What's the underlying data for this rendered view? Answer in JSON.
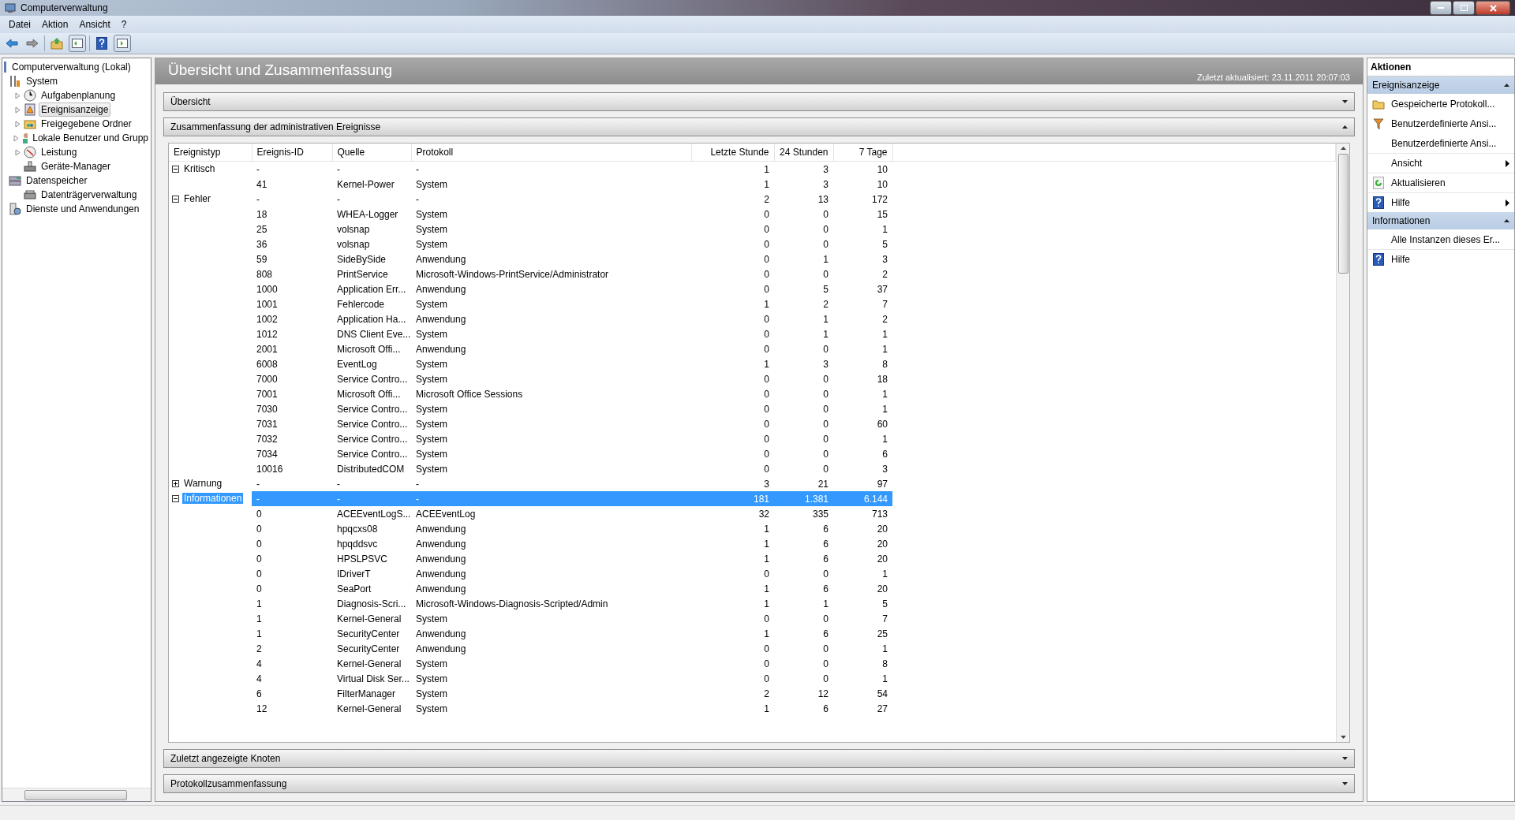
{
  "window": {
    "title": "Computerverwaltung"
  },
  "menu": [
    "Datei",
    "Aktion",
    "Ansicht",
    "?"
  ],
  "tree": [
    {
      "label": "Computerverwaltung (Lokal)",
      "selected": false,
      "children": [
        {
          "label": "System",
          "selected": false,
          "children": [
            {
              "label": "Aufgabenplanung",
              "selected": false,
              "collapsed": true
            },
            {
              "label": "Ereignisanzeige",
              "selected": true,
              "collapsed": true
            },
            {
              "label": "Freigegebene Ordner",
              "selected": false,
              "collapsed": true
            },
            {
              "label": "Lokale Benutzer und Grupp",
              "selected": false,
              "collapsed": true
            },
            {
              "label": "Leistung",
              "selected": false,
              "collapsed": true
            },
            {
              "label": "Geräte-Manager",
              "selected": false,
              "collapsed": false
            }
          ]
        },
        {
          "label": "Datenspeicher",
          "selected": false,
          "children": [
            {
              "label": "Datenträgerverwaltung",
              "selected": false,
              "collapsed": false
            }
          ]
        },
        {
          "label": "Dienste und Anwendungen",
          "selected": false
        }
      ]
    }
  ],
  "header": {
    "title": "Übersicht und Zusammenfassung",
    "updated": "Zuletzt aktualisiert: 23.11.2011 20:07:03"
  },
  "panels": [
    {
      "title": "Übersicht",
      "expanded": false
    },
    {
      "title": "Zusammenfassung der administrativen Ereignisse",
      "expanded": true,
      "table": {
        "columns": [
          "Ereignistyp",
          "Ereignis-ID",
          "Quelle",
          "Protokoll",
          "Letzte Stunde",
          "24 Stunden",
          "7 Tage"
        ],
        "groups": [
          {
            "type": "Kritisch",
            "expanded": true,
            "selected": false,
            "id": "-",
            "source": "-",
            "log": "-",
            "hour": "1",
            "day": "3",
            "week": "10",
            "children": [
              {
                "id": "41",
                "source": "Kernel-Power",
                "log": "System",
                "hour": "1",
                "day": "3",
                "week": "10"
              }
            ]
          },
          {
            "type": "Fehler",
            "expanded": true,
            "selected": false,
            "id": "-",
            "source": "-",
            "log": "-",
            "hour": "2",
            "day": "13",
            "week": "172",
            "children": [
              {
                "id": "18",
                "source": "WHEA-Logger",
                "log": "System",
                "hour": "0",
                "day": "0",
                "week": "15"
              },
              {
                "id": "25",
                "source": "volsnap",
                "log": "System",
                "hour": "0",
                "day": "0",
                "week": "1"
              },
              {
                "id": "36",
                "source": "volsnap",
                "log": "System",
                "hour": "0",
                "day": "0",
                "week": "5"
              },
              {
                "id": "59",
                "source": "SideBySide",
                "log": "Anwendung",
                "hour": "0",
                "day": "1",
                "week": "3"
              },
              {
                "id": "808",
                "source": "PrintService",
                "log": "Microsoft-Windows-PrintService/Administrator",
                "hour": "0",
                "day": "0",
                "week": "2"
              },
              {
                "id": "1000",
                "source": "Application Err...",
                "log": "Anwendung",
                "hour": "0",
                "day": "5",
                "week": "37"
              },
              {
                "id": "1001",
                "source": "Fehlercode",
                "log": "System",
                "hour": "1",
                "day": "2",
                "week": "7"
              },
              {
                "id": "1002",
                "source": "Application Ha...",
                "log": "Anwendung",
                "hour": "0",
                "day": "1",
                "week": "2"
              },
              {
                "id": "1012",
                "source": "DNS Client Eve...",
                "log": "System",
                "hour": "0",
                "day": "1",
                "week": "1"
              },
              {
                "id": "2001",
                "source": "Microsoft Offi...",
                "log": "Anwendung",
                "hour": "0",
                "day": "0",
                "week": "1"
              },
              {
                "id": "6008",
                "source": "EventLog",
                "log": "System",
                "hour": "1",
                "day": "3",
                "week": "8"
              },
              {
                "id": "7000",
                "source": "Service Contro...",
                "log": "System",
                "hour": "0",
                "day": "0",
                "week": "18"
              },
              {
                "id": "7001",
                "source": "Microsoft Offi...",
                "log": "Microsoft Office Sessions",
                "hour": "0",
                "day": "0",
                "week": "1"
              },
              {
                "id": "7030",
                "source": "Service Contro...",
                "log": "System",
                "hour": "0",
                "day": "0",
                "week": "1"
              },
              {
                "id": "7031",
                "source": "Service Contro...",
                "log": "System",
                "hour": "0",
                "day": "0",
                "week": "60"
              },
              {
                "id": "7032",
                "source": "Service Contro...",
                "log": "System",
                "hour": "0",
                "day": "0",
                "week": "1"
              },
              {
                "id": "7034",
                "source": "Service Contro...",
                "log": "System",
                "hour": "0",
                "day": "0",
                "week": "6"
              },
              {
                "id": "10016",
                "source": "DistributedCOM",
                "log": "System",
                "hour": "0",
                "day": "0",
                "week": "3"
              }
            ]
          },
          {
            "type": "Warnung",
            "expanded": false,
            "selected": false,
            "id": "-",
            "source": "-",
            "log": "-",
            "hour": "3",
            "day": "21",
            "week": "97"
          },
          {
            "type": "Informationen",
            "expanded": true,
            "selected": true,
            "id": "-",
            "source": "-",
            "log": "-",
            "hour": "181",
            "day": "1.381",
            "week": "6.144",
            "children": [
              {
                "id": "0",
                "source": "ACEEventLogS...",
                "log": "ACEEventLog",
                "hour": "32",
                "day": "335",
                "week": "713"
              },
              {
                "id": "0",
                "source": "hpqcxs08",
                "log": "Anwendung",
                "hour": "1",
                "day": "6",
                "week": "20"
              },
              {
                "id": "0",
                "source": "hpqddsvc",
                "log": "Anwendung",
                "hour": "1",
                "day": "6",
                "week": "20"
              },
              {
                "id": "0",
                "source": "HPSLPSVC",
                "log": "Anwendung",
                "hour": "1",
                "day": "6",
                "week": "20"
              },
              {
                "id": "0",
                "source": "IDriverT",
                "log": "Anwendung",
                "hour": "0",
                "day": "0",
                "week": "1"
              },
              {
                "id": "0",
                "source": "SeaPort",
                "log": "Anwendung",
                "hour": "1",
                "day": "6",
                "week": "20"
              },
              {
                "id": "1",
                "source": "Diagnosis-Scri...",
                "log": "Microsoft-Windows-Diagnosis-Scripted/Admin",
                "hour": "1",
                "day": "1",
                "week": "5"
              },
              {
                "id": "1",
                "source": "Kernel-General",
                "log": "System",
                "hour": "0",
                "day": "0",
                "week": "7"
              },
              {
                "id": "1",
                "source": "SecurityCenter",
                "log": "Anwendung",
                "hour": "1",
                "day": "6",
                "week": "25"
              },
              {
                "id": "2",
                "source": "SecurityCenter",
                "log": "Anwendung",
                "hour": "0",
                "day": "0",
                "week": "1"
              },
              {
                "id": "4",
                "source": "Kernel-General",
                "log": "System",
                "hour": "0",
                "day": "0",
                "week": "8"
              },
              {
                "id": "4",
                "source": "Virtual Disk Ser...",
                "log": "System",
                "hour": "0",
                "day": "0",
                "week": "1"
              },
              {
                "id": "6",
                "source": "FilterManager",
                "log": "System",
                "hour": "2",
                "day": "12",
                "week": "54"
              },
              {
                "id": "12",
                "source": "Kernel-General",
                "log": "System",
                "hour": "1",
                "day": "6",
                "week": "27"
              }
            ]
          }
        ]
      }
    },
    {
      "title": "Zuletzt angezeigte Knoten",
      "expanded": false
    },
    {
      "title": "Protokollzusammenfassung",
      "expanded": false
    }
  ],
  "actions": {
    "title": "Aktionen",
    "sections": [
      {
        "title": "Ereignisanzeige",
        "expanded": true,
        "items": [
          {
            "label": "Gespeicherte Protokoll...",
            "submenu": false
          },
          {
            "label": "Benutzerdefinierte Ansi...",
            "submenu": false
          },
          {
            "label": "Benutzerdefinierte Ansi...",
            "submenu": false
          },
          {
            "label": "Ansicht",
            "submenu": true
          },
          {
            "label": "Aktualisieren",
            "submenu": false
          },
          {
            "label": "Hilfe",
            "submenu": true
          }
        ]
      },
      {
        "title": "Informationen",
        "expanded": true,
        "items": [
          {
            "label": "Alle Instanzen dieses Er...",
            "submenu": false
          },
          {
            "label": "Hilfe",
            "submenu": false
          }
        ]
      }
    ]
  }
}
